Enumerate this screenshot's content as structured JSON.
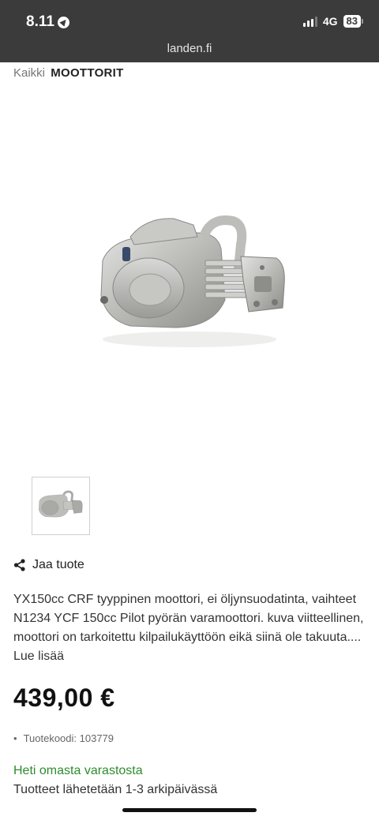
{
  "status_bar": {
    "time": "8.11",
    "network": "4G",
    "battery": "83"
  },
  "browser": {
    "url": "landen.fi"
  },
  "breadcrumb": {
    "prefix": "Kaikki",
    "category": "MOOTTORIT"
  },
  "share": {
    "label": "Jaa tuote"
  },
  "product": {
    "description": "YX150cc CRF tyyppinen moottori, ei öljynsuodatinta, vaihteet N1234 YCF 150cc Pilot pyörän varamoottori. kuva viitteellinen, moottori on tarkoitettu kilpailukäyttöön eikä siinä ole takuuta....",
    "read_more": "Lue lisää",
    "price": "439,00 €",
    "sku": "Tuotekoodi: 103779",
    "stock": "Heti omasta varastosta",
    "shipping": "Tuotteet lähetetään 1-3 arkipäivässä"
  },
  "colors": {
    "topbar": "#3b3b3b",
    "stock_green": "#2e8b2e"
  },
  "icons": {
    "share": "share-icon",
    "location": "location-arrow-icon"
  }
}
